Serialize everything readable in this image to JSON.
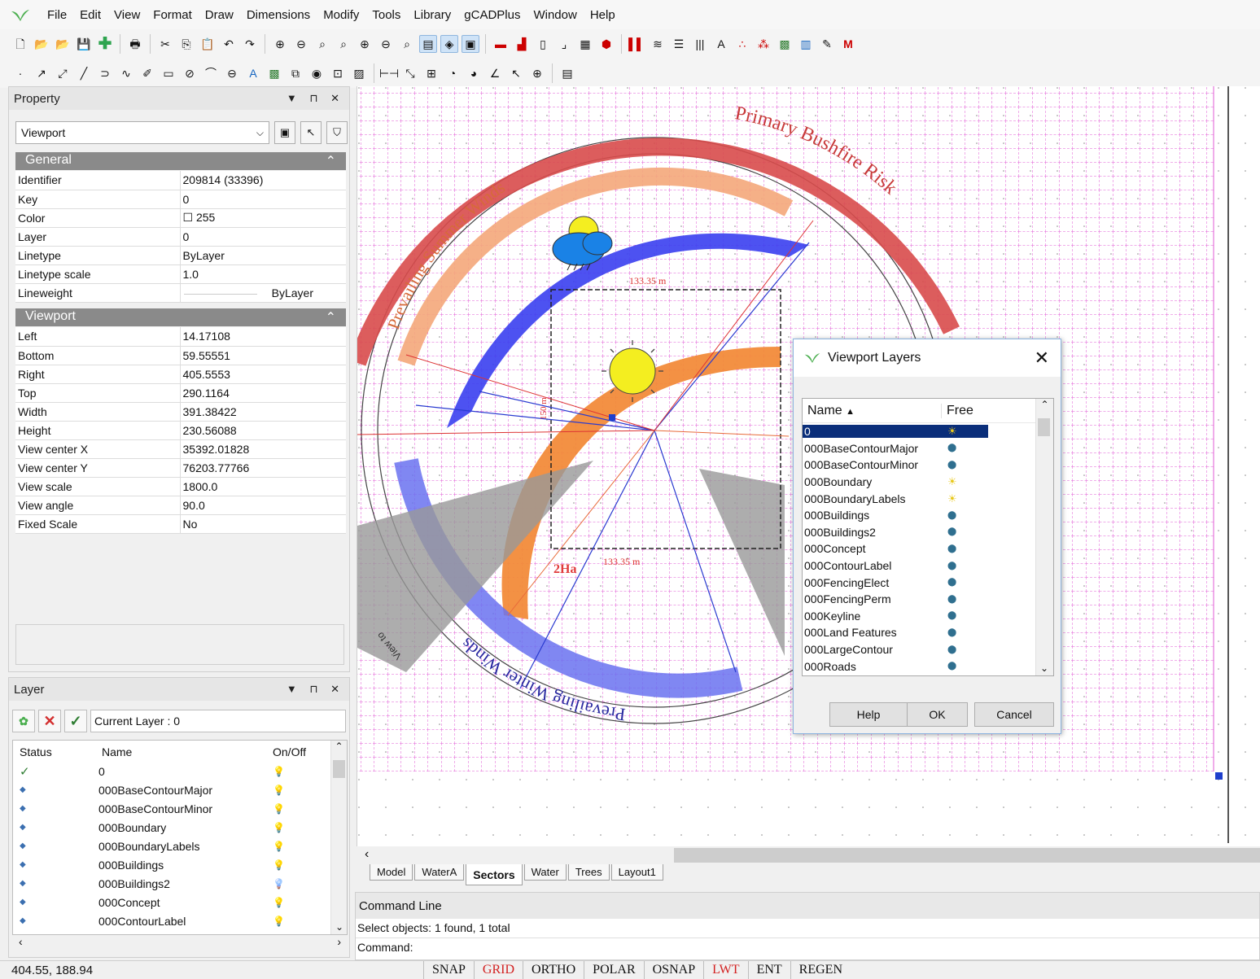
{
  "menu": [
    "File",
    "Edit",
    "View",
    "Format",
    "Draw",
    "Dimensions",
    "Modify",
    "Tools",
    "Library",
    "gCADPlus",
    "Window",
    "Help"
  ],
  "colors": {
    "grid": "#e05bd6",
    "accent": "#0a2e7a",
    "statusOn": "#d21f1f"
  },
  "property": {
    "title": "Property",
    "selector": "Viewport",
    "general_header": "General",
    "general": [
      {
        "k": "Identifier",
        "v": "209814 (33396)"
      },
      {
        "k": "Key",
        "v": "0"
      },
      {
        "k": "Color",
        "v": "☐ 255"
      },
      {
        "k": "Layer",
        "v": "0"
      },
      {
        "k": "Linetype",
        "v": "ByLayer"
      },
      {
        "k": "Linetype scale",
        "v": "1.0"
      },
      {
        "k": "Lineweight",
        "v": "ByLayer"
      }
    ],
    "viewport_header": "Viewport",
    "viewport": [
      {
        "k": "Left",
        "v": "14.17108"
      },
      {
        "k": "Bottom",
        "v": "59.55551"
      },
      {
        "k": "Right",
        "v": "405.5553"
      },
      {
        "k": "Top",
        "v": "290.1164"
      },
      {
        "k": "Width",
        "v": "391.38422"
      },
      {
        "k": "Height",
        "v": "230.56088"
      },
      {
        "k": "View center X",
        "v": "35392.01828"
      },
      {
        "k": "View center Y",
        "v": "76203.77766"
      },
      {
        "k": "View scale",
        "v": "1800.0"
      },
      {
        "k": "View angle",
        "v": "90.0"
      },
      {
        "k": "Fixed Scale",
        "v": "No"
      }
    ]
  },
  "layer": {
    "title": "Layer",
    "current": "Current Layer : 0",
    "headers": {
      "status": "Status",
      "name": "Name",
      "onoff": "On/Off"
    },
    "rows": [
      {
        "name": "0",
        "status": "✓"
      },
      {
        "name": "000BaseContourMajor",
        "status": "◆"
      },
      {
        "name": "000BaseContourMinor",
        "status": "◆"
      },
      {
        "name": "000Boundary",
        "status": "◆"
      },
      {
        "name": "000BoundaryLabels",
        "status": "◆"
      },
      {
        "name": "000Buildings",
        "status": "◆"
      },
      {
        "name": "000Buildings2",
        "status": "◆"
      },
      {
        "name": "000Concept",
        "status": "◆"
      },
      {
        "name": "000ContourLabel",
        "status": "◆"
      }
    ]
  },
  "drawing": {
    "label_primary": "Primary Bushfire Risk",
    "label_summer": "Prevailing Summer Winds",
    "label_winter": "Prevailing Winter Winds",
    "label_view": "View to",
    "dim_top": "133.35 m",
    "dim_bottom": "133.35 m",
    "dim_side": "150 m",
    "area": "2Ha"
  },
  "tabs": [
    "Model",
    "WaterA",
    "Sectors",
    "Water",
    "Trees",
    "Layout1"
  ],
  "active_tab": "Sectors",
  "command": {
    "title": "Command Line",
    "line1": "Select objects: 1 found,  1 total",
    "line2": "Command:"
  },
  "status": {
    "coords": "404.55, 188.94",
    "buttons": [
      "SNAP",
      "GRID",
      "ORTHO",
      "POLAR",
      "OSNAP",
      "LWT",
      "ENT",
      "REGEN"
    ],
    "on": [
      "GRID",
      "LWT"
    ]
  },
  "viewport_layers": {
    "title": "Viewport Layers",
    "col_name": "Name",
    "col_free": "Free",
    "rows": [
      "0",
      "000BaseContourMajor",
      "000BaseContourMinor",
      "000Boundary",
      "000BoundaryLabels",
      "000Buildings",
      "000Buildings2",
      "000Concept",
      "000ContourLabel",
      "000FencingElect",
      "000FencingPerm",
      "000Keyline",
      "000Land Features",
      "000LargeContour",
      "000Roads"
    ],
    "yellow": [
      "0",
      "000Boundary",
      "000BoundaryLabels"
    ],
    "help": "Help",
    "ok": "OK",
    "cancel": "Cancel"
  }
}
